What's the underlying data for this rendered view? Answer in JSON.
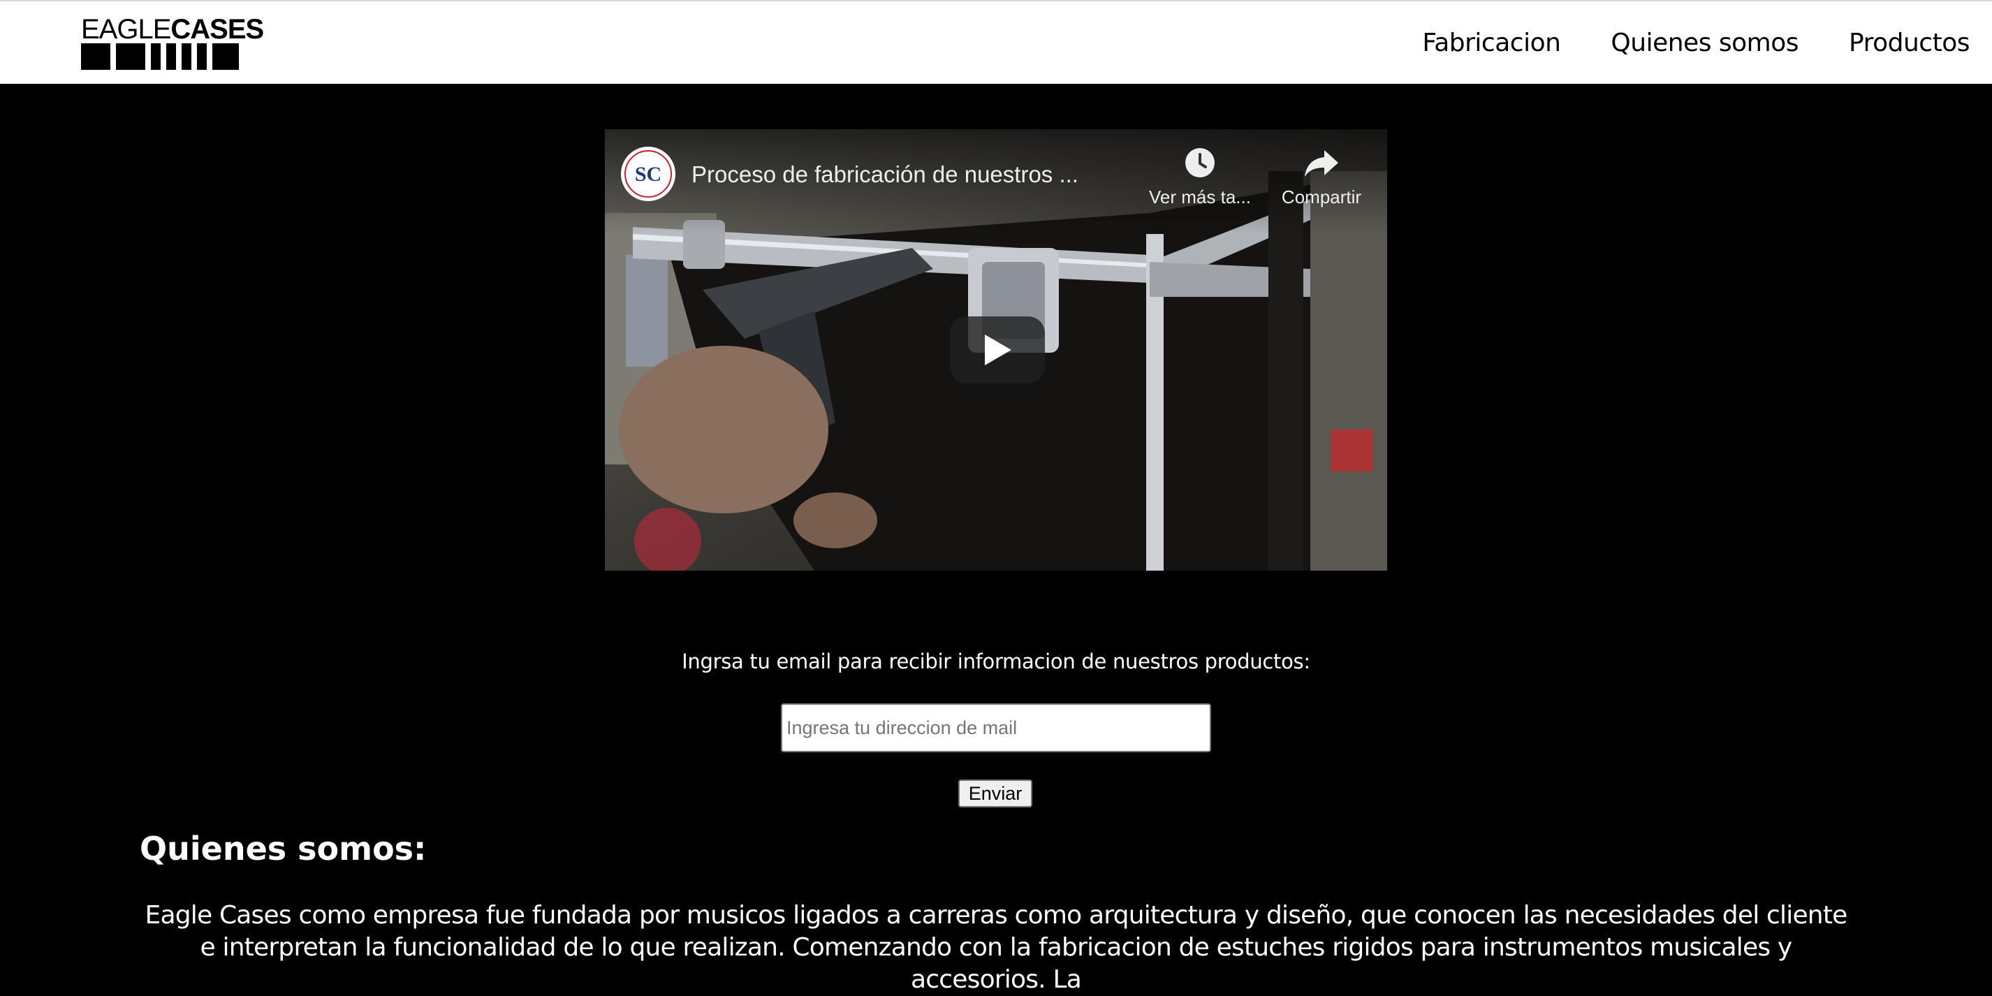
{
  "header": {
    "logo": {
      "part1": "EAGLE",
      "part2": "CASES"
    },
    "nav": [
      {
        "label": "Fabricacion"
      },
      {
        "label": "Quienes somos"
      },
      {
        "label": "Productos"
      }
    ]
  },
  "video": {
    "title": "Proceso de fabricación de nuestros ...",
    "watch_later_label": "Ver más ta...",
    "share_label": "Compartir",
    "channel_icon": "sylvancases-logo-icon",
    "play_icon": "play-icon"
  },
  "signup": {
    "label": "Ingrsa tu email para recibir informacion de nuestros productos:",
    "email_value": "",
    "email_placeholder": "Ingresa tu direccion de mail",
    "submit_label": "Enviar"
  },
  "about": {
    "title": "Quienes somos:",
    "text": "Eagle Cases como empresa fue fundada por musicos ligados a carreras como arquitectura y diseño, que conocen las necesidades del cliente e interpretan la funcionalidad de lo que realizan. Comenzando con la fabricacion de estuches rigidos para instrumentos musicales y accesorios. La"
  },
  "colors": {
    "page_background": "#000000",
    "header_background": "#ffffff",
    "text_on_dark": "#ffffff"
  }
}
